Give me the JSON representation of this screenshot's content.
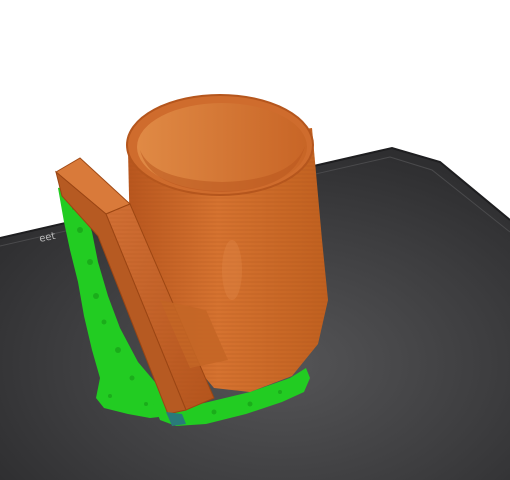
{
  "app": {
    "view": "3d-preview"
  },
  "bed": {
    "label": "eet",
    "color": "#3a3a3c",
    "edge_color": "#2a2a2c"
  },
  "model": {
    "body_color": "#cc6a2c",
    "support_color": "#22cc22",
    "wipe_color": "#2a7a7a"
  }
}
